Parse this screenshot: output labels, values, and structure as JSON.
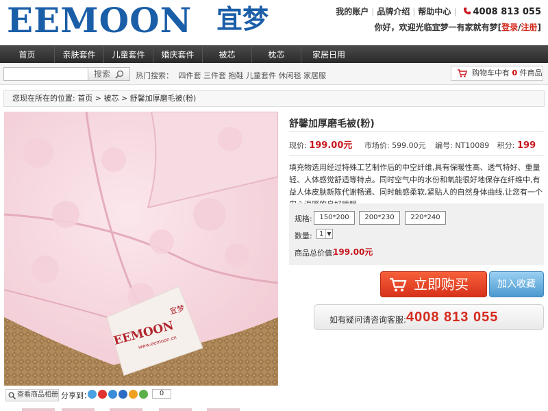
{
  "brand": {
    "logo_en": "EEMOON",
    "logo_cn": "宜梦",
    "tag_en": "EEMOON",
    "tag_cn": "宜梦",
    "tag_url": "www.eemoon.cn"
  },
  "toplinks": {
    "account": "我的账户",
    "brand_intro": "品牌介绍",
    "help": "帮助中心",
    "phone": "4008 813 055"
  },
  "welcome": {
    "text": "你好，欢迎光临宜梦一有家就有梦",
    "login": "登录",
    "sep": "/",
    "register": "注册",
    "open": "[",
    "close": "]"
  },
  "nav": {
    "items": [
      "首页",
      "亲肤套件",
      "儿童套件",
      "婚庆套件",
      "被芯",
      "枕芯",
      "家居日用"
    ]
  },
  "search": {
    "placeholder": "",
    "button": "搜索",
    "hot_label": "热门搜索：",
    "hot_terms": [
      "四件套",
      "三件套",
      "抱鞋",
      "儿童套件",
      "休闲毯",
      "家居服"
    ]
  },
  "cart": {
    "prefix": "购物车中有",
    "count": "0",
    "suffix": "件商品"
  },
  "breadcrumb": {
    "label": "您现在所在的位置:",
    "items": [
      "首页",
      "被芯",
      "舒馨加厚磨毛被(粉)"
    ],
    "sep": ">"
  },
  "gallery": {
    "album_button": "查看商品相册",
    "share_label": "分享到：",
    "share_count": "0"
  },
  "product": {
    "title": "舒馨加厚磨毛被(粉)",
    "price_label": "现价:",
    "price": "199.00元",
    "market_label": "市场价:",
    "market_price": "599.00元",
    "sku_label": "编号:",
    "sku": "NT10089",
    "points_label": "积分:",
    "points": "199",
    "description": "填充物选用经过特殊工艺制作后的中空纤维,具有保暖性高、透气特好、重量轻、人体感觉舒适等特点。同时空气中的水份和氧能很好地保存在纤维中,有益人体皮肤新陈代谢畅通、同时触感柔软,紧贴人的自然身体曲线,让您有一个安心温暖的良好睡眠。",
    "spec_label": "规格:",
    "sizes": [
      "150*200",
      "200*230",
      "220*240"
    ],
    "qty_label": "数量:",
    "qty": "1",
    "total_label": "商品总价值:",
    "total": "199.00元",
    "buy_button": "立即购买",
    "fav_button": "加入收藏",
    "hotline_label": "如有疑问请咨询客服:",
    "hotline": "4008 813 055"
  },
  "colors": {
    "brand_blue": "#1a5ea8",
    "price_red": "#c8161d",
    "buy_orange": "#e8452a",
    "fav_blue": "#5aa7dc",
    "nav_dark": "#333333"
  },
  "icons": [
    "phone-icon",
    "search-icon",
    "cart-icon",
    "magnifier-icon",
    "cart-buy-icon"
  ]
}
